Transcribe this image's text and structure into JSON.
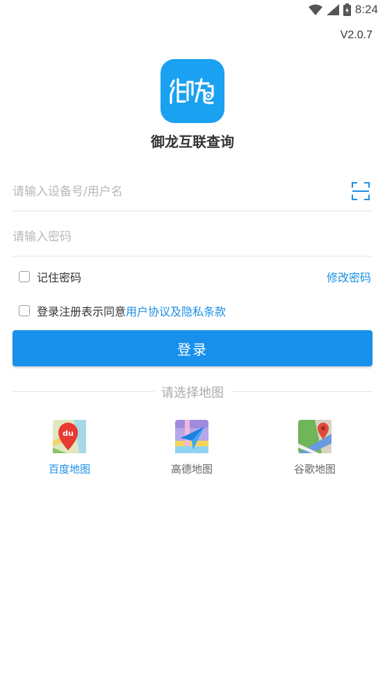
{
  "status_bar": {
    "time": "8:24"
  },
  "version": "V2.0.7",
  "app": {
    "name": "御龙互联查询",
    "brand_color": "#1aa1f1"
  },
  "login_form": {
    "username_placeholder": "请输入设备号/用户名",
    "password_placeholder": "请输入密码",
    "remember_label": "记住密码",
    "change_password_link": "修改密码",
    "agreement_prefix": "登录注册表示同意",
    "agreement_link": "用户协议及隐私条款",
    "login_button": "登录"
  },
  "map_select": {
    "title": "请选择地图",
    "options": [
      {
        "label": "百度地图",
        "icon": "baidu-map-icon",
        "selected": true
      },
      {
        "label": "高德地图",
        "icon": "amap-icon",
        "selected": false
      },
      {
        "label": "谷歌地图",
        "icon": "google-maps-icon",
        "selected": false
      }
    ]
  },
  "colors": {
    "accent": "#1890ec",
    "link": "#1a8fe6"
  }
}
